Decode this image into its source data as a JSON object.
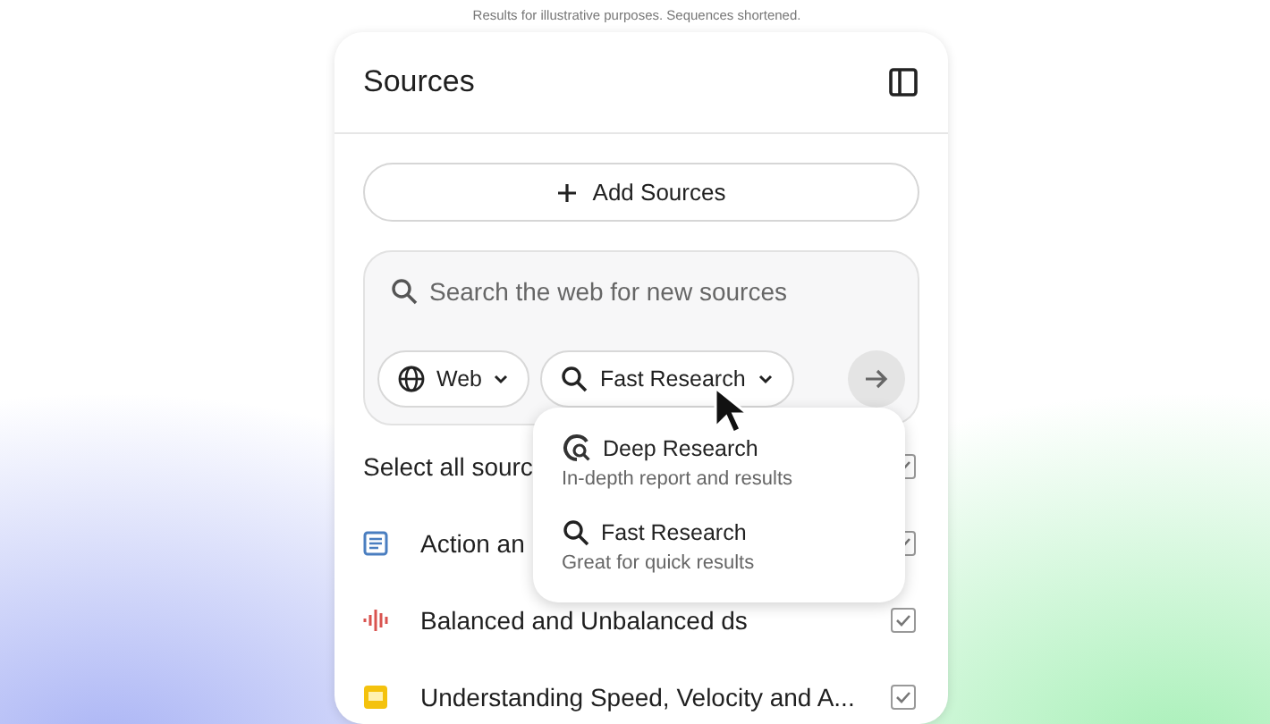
{
  "caption": "Results for illustrative purposes. Sequences shortened.",
  "panel": {
    "title": "Sources",
    "add_button": "Add Sources",
    "search": {
      "placeholder": "Search the web for new sources",
      "chips": [
        {
          "kind": "globe",
          "label": "Web"
        },
        {
          "kind": "search",
          "label": "Fast Research"
        }
      ]
    },
    "select_all": {
      "label": "Select all sourc",
      "checked": true
    },
    "sources": [
      {
        "kind": "doc",
        "title": "Action an",
        "checked": true
      },
      {
        "kind": "audio",
        "title": "Balanced and Unbalanced ds",
        "checked": true
      },
      {
        "kind": "slides",
        "title": "Understanding Speed, Velocity and A...",
        "checked": true
      }
    ]
  },
  "dropdown": {
    "items": [
      {
        "kind": "deep",
        "title": "Deep Research",
        "subtitle": "In-depth report and results"
      },
      {
        "kind": "search",
        "title": "Fast Research",
        "subtitle": "Great for quick results"
      }
    ]
  }
}
